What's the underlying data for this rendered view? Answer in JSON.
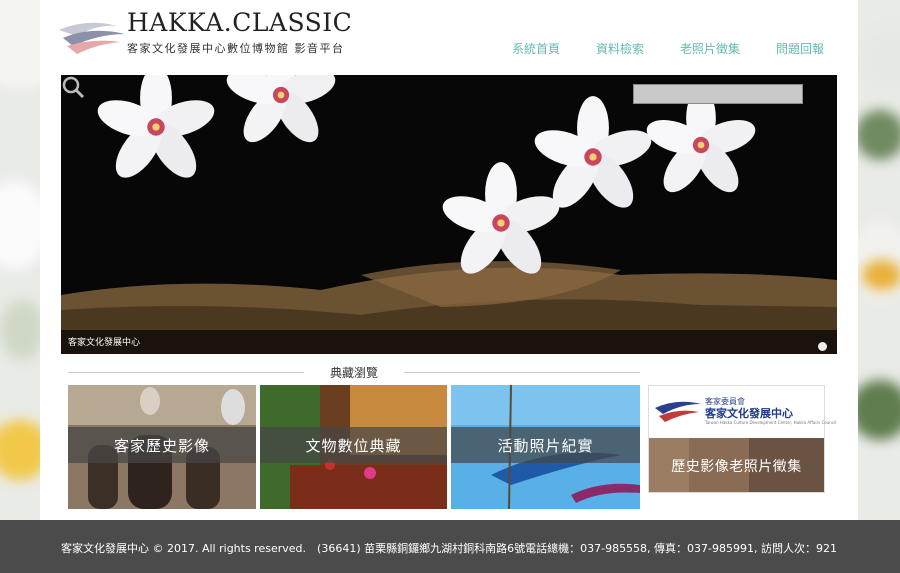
{
  "brand": {
    "title": "HAKKA.CLASSIC",
    "subtitle": "客家文化發展中心數位博物館 影音平台"
  },
  "nav": {
    "items": [
      "系統首頁",
      "資料檢索",
      "老照片徵集",
      "問題回報"
    ]
  },
  "search": {
    "value": "",
    "placeholder": ""
  },
  "hero": {
    "caption": "客家文化發展中心"
  },
  "section": {
    "title": "典藏瀏覽"
  },
  "tiles": [
    {
      "label": "客家歷史影像"
    },
    {
      "label": "文物數位典藏"
    },
    {
      "label": "活動照片紀實"
    }
  ],
  "side": {
    "org_line1": "客家委員會",
    "org_line2": "客家文化發展中心",
    "org_line3": "Taiwan Hakka Culture Development Center, Hakka Affairs Council",
    "banner_label": "歷史影像老照片徵集"
  },
  "footer": {
    "copyright": "客家文化發展中心 © 2017. All rights reserved.",
    "address": "(36641) 苗栗縣銅鑼鄉九湖村銅科南路6號電話總機：037-985558, 傳真：037-985991, 訪問人次：921"
  },
  "colors": {
    "nav": "#66b9b2",
    "footer": "#4b4b4b"
  }
}
